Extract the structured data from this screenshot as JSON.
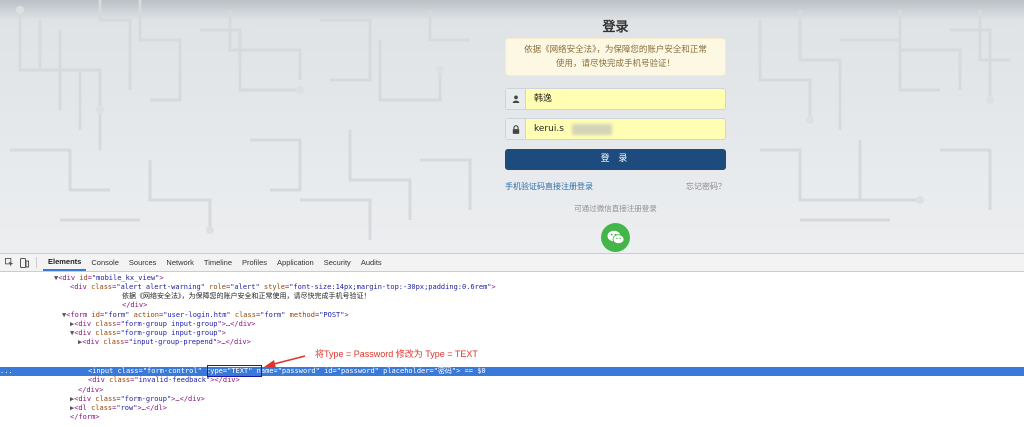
{
  "login": {
    "title": "登录",
    "alert_text_1": "依据《网络安全法》，为保障您的账户安全和正常",
    "alert_text_2": "使用，请尽快完成手机号验证！",
    "username_value": "韩逸",
    "password_value": "kerui.s",
    "submit_label": "登 录",
    "sms_link": "手机验证码直接注册登录",
    "forgot_link": "忘记密码？",
    "wechat_tip": "可通过微信直接注册登录",
    "icons": [
      "user-icon",
      "lock-icon",
      "wechat-icon"
    ],
    "colors": {
      "button": "#1e4b7e",
      "alert_bg": "#fcf8e3",
      "input_autofill": "#fffeb3",
      "wechat": "#44b549"
    }
  },
  "devtools": {
    "tabs": [
      "Elements",
      "Console",
      "Sources",
      "Network",
      "Timeline",
      "Profiles",
      "Application",
      "Security",
      "Audits"
    ],
    "active_tab": "Elements",
    "annotation": "将Type = Password 修改为 Type = TEXT",
    "dom": {
      "l1_tag": "<div ",
      "l1_attr": "id",
      "l1_val": "\"mobile_kx_view\"",
      "l1_end": ">",
      "l2_tag": "<div ",
      "l2_attr1": "class",
      "l2_val1": "\"alert alert-warning\"",
      "l2_attr2": " role",
      "l2_val2": "\"alert\"",
      "l2_attr3": " style",
      "l2_val3": "\"font-size:14px;margin-top:-30px;padding:0.6rem\"",
      "l2_end": ">",
      "l3_text": "依据《网络安全法》，为保障您的账户安全和正常使用，请尽快完成手机号验证！",
      "l4_close": "</div>",
      "l5_tag": "<form ",
      "l5_a1": "id",
      "l5_v1": "\"form\"",
      "l5_a2": " action",
      "l5_v2": "\"user-login.htm\"",
      "l5_a3": " class",
      "l5_v3": "\"form\"",
      "l5_a4": " method",
      "l5_v4": "\"POST\"",
      "l5_end": ">",
      "l6_tag": "<div ",
      "l6_a": "class",
      "l6_v": "\"form-group input-group\"",
      "l6_end": ">…</div>",
      "l7_tag": "<div ",
      "l7_a": "class",
      "l7_v": "\"form-group input-group\"",
      "l7_end": ">",
      "l8_tag": "<div ",
      "l8_a": "class",
      "l8_v": "\"input-group-prepend\"",
      "l8_end": ">…</div>",
      "l9_prefix": "...",
      "l9_tag": "<input ",
      "l9_a1": "class",
      "l9_v1": "\"form-control\"",
      "l9_a2": " type",
      "l9_v2": "\"TEXT\"",
      "l9_a3": " name",
      "l9_v3": "\"password\"",
      "l9_a4": " id",
      "l9_v4": "\"password\"",
      "l9_a5": " placeholder",
      "l9_v5": "\"密码\"",
      "l9_end": "> == $0",
      "l10_tag": "<div ",
      "l10_a": "class",
      "l10_v": "\"invalid-feedback\"",
      "l10_end": "></div>",
      "l11_close": "</div>",
      "l12_tag": "<div ",
      "l12_a": "class",
      "l12_v": "\"form-group\"",
      "l12_end": ">…</div>",
      "l13_tag": "<dl ",
      "l13_a": "class",
      "l13_v": "\"row\"",
      "l13_end": ">…</dl>",
      "l14_close": "</form>"
    }
  }
}
